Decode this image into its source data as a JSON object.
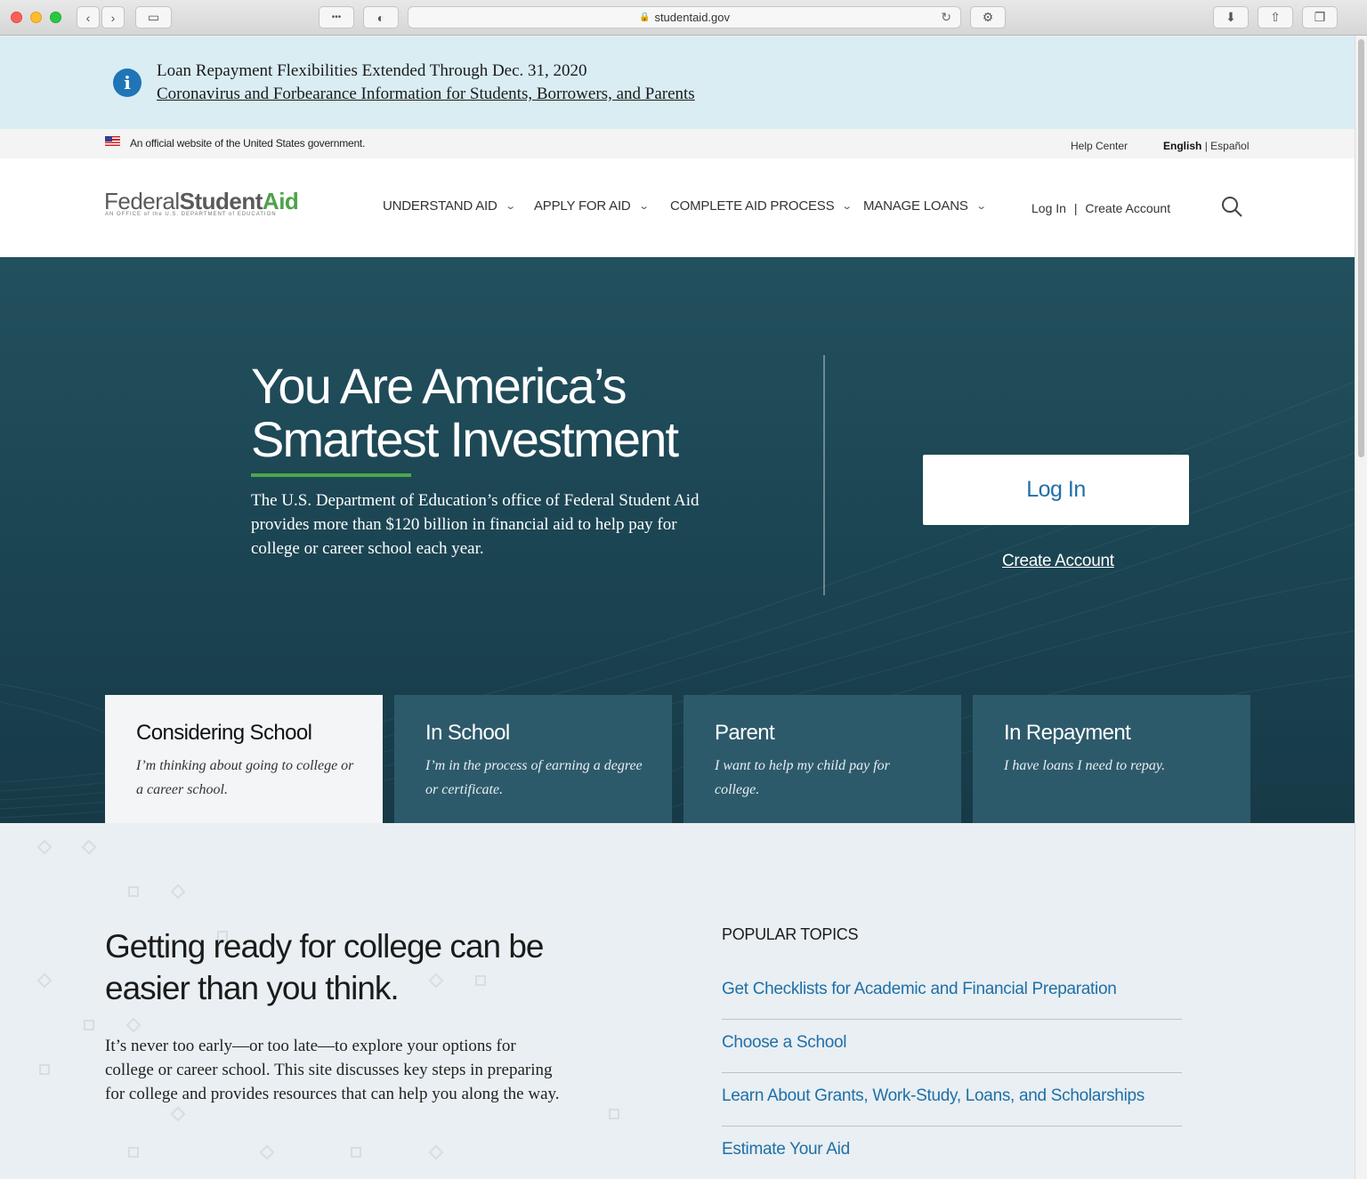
{
  "browser": {
    "url": "studentaid.gov"
  },
  "alert": {
    "title": "Loan Repayment Flexibilities Extended Through Dec. 31, 2020",
    "link": "Coronavirus and Forbearance Information for Students, Borrowers, and Parents"
  },
  "govbar": {
    "official": "An official website of the United States government.",
    "help": "Help Center",
    "lang_en": "English",
    "lang_sep": "|",
    "lang_es": "Español"
  },
  "header": {
    "logo_part1": "Federal",
    "logo_part2": "Student",
    "logo_part3": "Aid",
    "logo_sub": "AN OFFICE of the U.S. DEPARTMENT of EDUCATION",
    "nav": [
      {
        "label": "UNDERSTAND AID"
      },
      {
        "label": "APPLY FOR AID"
      },
      {
        "label": "COMPLETE AID PROCESS"
      },
      {
        "label": "MANAGE LOANS"
      }
    ],
    "login": "Log In",
    "separator": "|",
    "create": "Create Account"
  },
  "hero": {
    "title_line1": "You Are America’s",
    "title_line2": "Smartest Investment",
    "description": "The U.S. Department of Education’s office of Federal Student Aid provides more than $120 billion in financial aid to help pay for college or career school each year.",
    "login_button": "Log In",
    "create_account": "Create Account"
  },
  "cards": [
    {
      "title": "Considering School",
      "desc": "I’m thinking about going to college or a career school."
    },
    {
      "title": "In School",
      "desc": "I’m in the process of earning a degree or certificate."
    },
    {
      "title": "Parent",
      "desc": "I want to help my child pay for college."
    },
    {
      "title": "In Repayment",
      "desc": "I have loans I need to repay."
    }
  ],
  "lower": {
    "title_line1": "Getting ready for college can be",
    "title_line2": "easier than you think.",
    "description": "It’s never too early—or too late—to explore your options for college or career school. This site discusses key steps in preparing for college and provides resources that can help you along the way.",
    "topics_heading": "POPULAR TOPICS",
    "topics": [
      {
        "label": "Get Checklists for Academic and Financial Preparation"
      },
      {
        "label": "Choose a School"
      },
      {
        "label": "Learn About Grants, Work-Study, Loans, and Scholarships"
      },
      {
        "label": "Estimate Your Aid"
      }
    ]
  },
  "colors": {
    "hero_bg": "#1b4452",
    "card_bg": "#2d5a6b",
    "accent_green": "#4da84a",
    "link_blue": "#1f6fa8",
    "alert_bg": "#d9edf3"
  }
}
